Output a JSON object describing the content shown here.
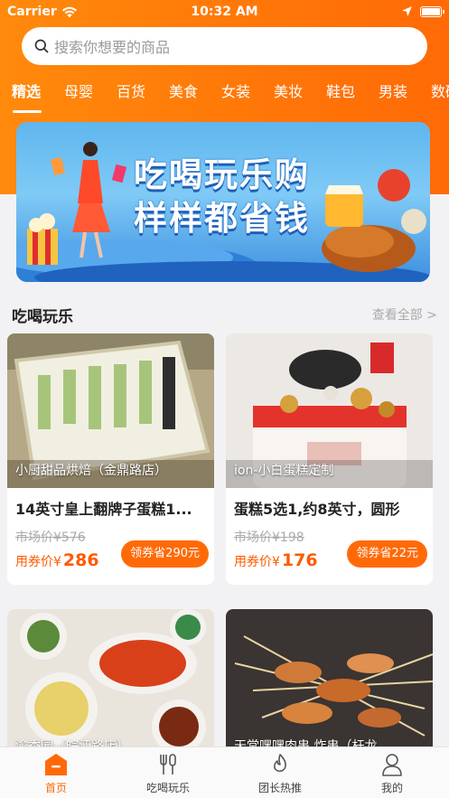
{
  "status_bar": {
    "carrier": "Carrier",
    "time": "10:32 AM"
  },
  "search": {
    "placeholder": "搜索你想要的商品"
  },
  "categories": [
    "精选",
    "母婴",
    "百货",
    "美食",
    "女装",
    "美妆",
    "鞋包",
    "男装",
    "数码"
  ],
  "banner": {
    "line1": "吃喝玩乐购",
    "line2": "样样都省钱"
  },
  "section": {
    "title": "吃喝玩乐",
    "more": "查看全部 >"
  },
  "products": [
    {
      "shop": "小厨甜品烘焙（金鼎路店）",
      "name": "14英寸皇上翻牌子蛋糕1...",
      "market_price": "市场价¥576",
      "price_label": "用券价¥",
      "price": "286",
      "coupon": "领券省290元"
    },
    {
      "shop": "ion-小白蛋糕定制",
      "name": "蛋糕5选1,约8英寸，圆形",
      "market_price": "市场价¥198",
      "price_label": "用券价¥",
      "price": "176",
      "coupon": "领券省22元"
    },
    {
      "shop": "渝香园（皖江路店）"
    },
    {
      "shop": "天堂嘿嘿肉串 炸串（杆龙"
    }
  ],
  "tabbar": [
    {
      "label": "首页",
      "icon": "home-icon",
      "active": true
    },
    {
      "label": "吃喝玩乐",
      "icon": "utensils-icon",
      "active": false
    },
    {
      "label": "团长热推",
      "icon": "flame-icon",
      "active": false
    },
    {
      "label": "我的",
      "icon": "user-icon",
      "active": false
    }
  ],
  "colors": {
    "accent": "#ff6a07",
    "header": "#ff7a0a",
    "banner": "#5fb6ee"
  }
}
